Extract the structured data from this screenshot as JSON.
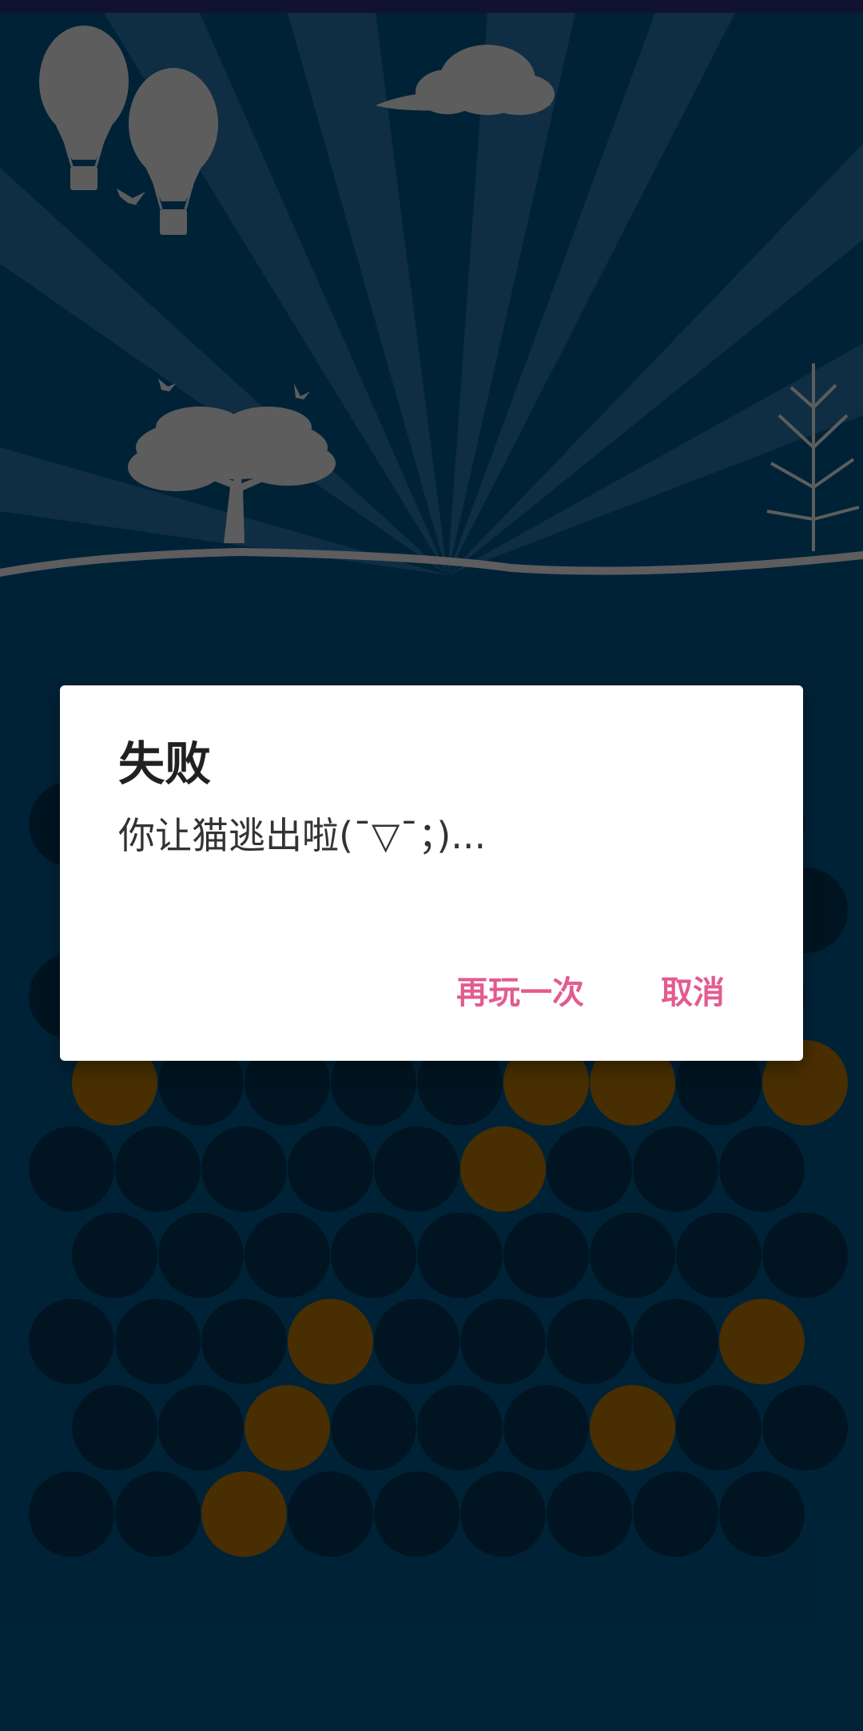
{
  "dialog": {
    "title": "失败",
    "message": "你让猫逃出啦(¯▽¯；)...",
    "replay_label": "再玩一次",
    "cancel_label": "取消"
  },
  "colors": {
    "status_bar": "#1a1a4a",
    "background": "#003352",
    "ray": "#2a5272",
    "silhouette": "#8a8a8a",
    "cell_empty": "#001f31",
    "cell_blocked": "#6b4500",
    "dialog_bg": "#ffffff",
    "title_text": "#212121",
    "message_text": "#333333",
    "button_text": "#e35b8f"
  },
  "board": {
    "rows": 9,
    "cols": 9,
    "blocked": [
      [
        1,
        0
      ],
      [
        1,
        1
      ],
      [
        1,
        6
      ],
      [
        1,
        7
      ],
      [
        3,
        0
      ],
      [
        3,
        5
      ],
      [
        3,
        6
      ],
      [
        3,
        8
      ],
      [
        4,
        5
      ],
      [
        6,
        3
      ],
      [
        6,
        8
      ],
      [
        7,
        2
      ],
      [
        7,
        6
      ],
      [
        8,
        2
      ]
    ]
  },
  "icons": {
    "balloons": "hot-air-balloon-icon",
    "cloud": "cloud-icon",
    "tree": "acacia-tree-icon",
    "bare_tree": "bare-tree-icon",
    "birds": "bird-icon"
  }
}
